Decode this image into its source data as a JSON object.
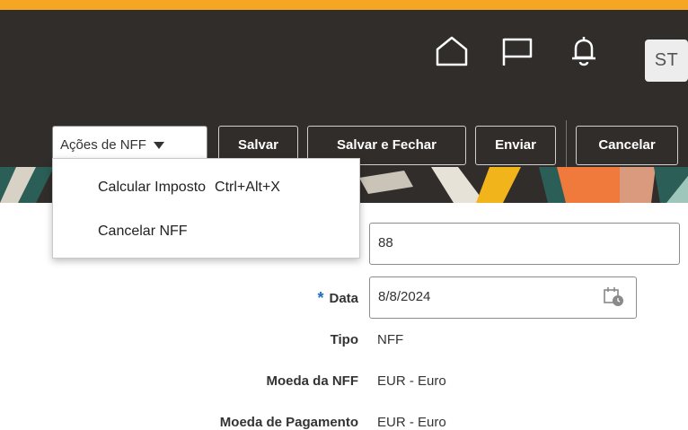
{
  "header": {
    "accent_color": "#f5a623",
    "background_color": "#312d2a",
    "avatar_initials": "ST",
    "icons": [
      "home-icon",
      "flag-icon",
      "bell-icon"
    ]
  },
  "toolbar": {
    "actions_label": "Ações de NFF",
    "save_label": "Salvar",
    "save_close_label": "Salvar e Fechar",
    "submit_label": "Enviar",
    "cancel_label": "Cancelar"
  },
  "actions_menu": {
    "items": [
      {
        "label": "Calcular Imposto",
        "shortcut": "Ctrl+Alt+X"
      },
      {
        "label": "Cancelar NFF",
        "shortcut": ""
      }
    ]
  },
  "form": {
    "number_value": "88",
    "date_required_mark": "*",
    "date_label": "Data",
    "date_value": "8/8/2024",
    "type_label": "Tipo",
    "type_value": "NFF",
    "currency_label": "Moeda da NFF",
    "currency_value": "EUR - Euro",
    "payment_currency_label": "Moeda de Pagamento",
    "payment_currency_value": "EUR - Euro"
  }
}
